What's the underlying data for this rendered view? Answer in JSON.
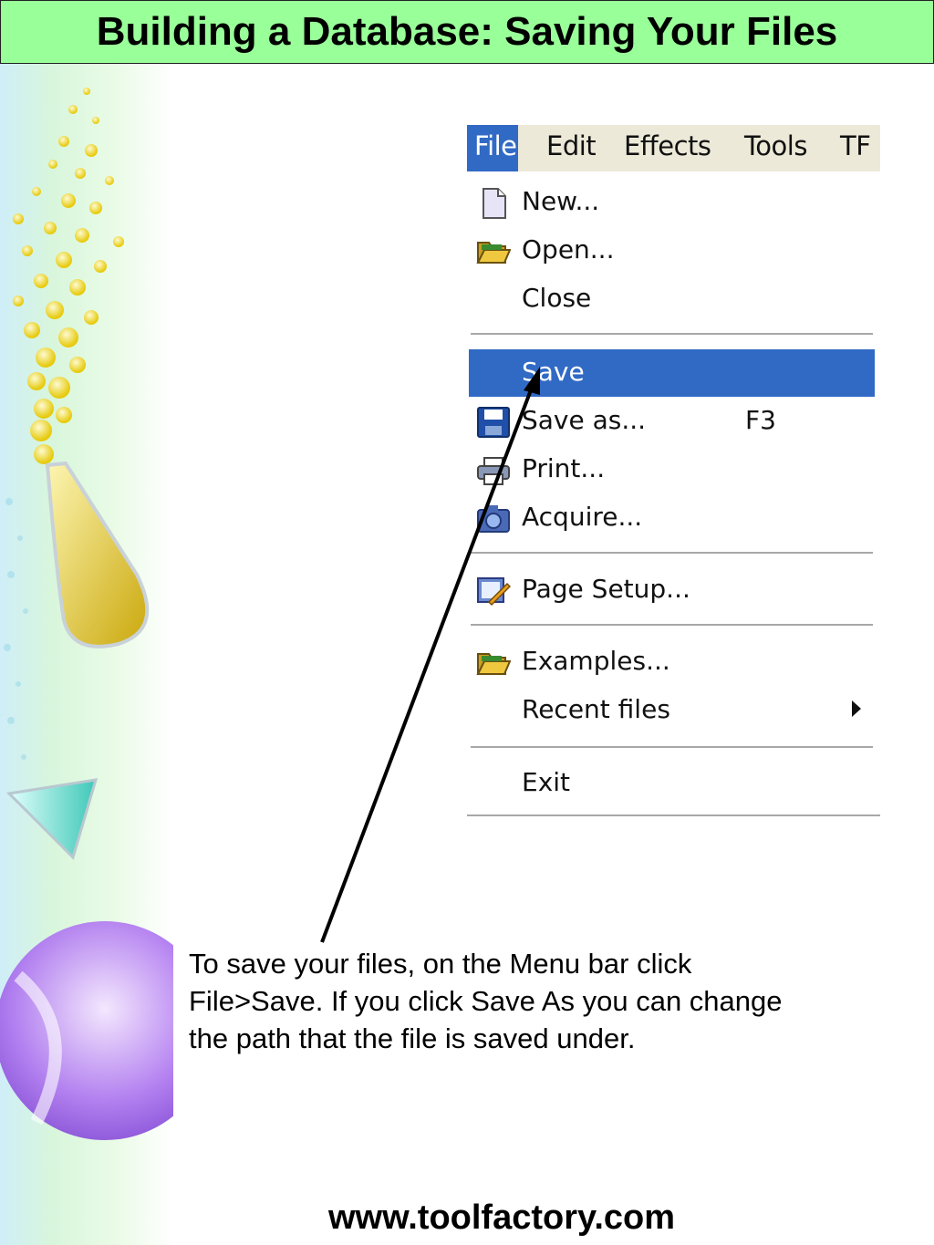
{
  "slide": {
    "title": "Building a Database: Saving Your Files",
    "caption": "To save your files, on the Menu bar click\nFile>Save.  If you click Save As you can change\nthe path that the file is saved under.",
    "footer_url": "www.toolfactory.com"
  },
  "menubar": {
    "items": [
      "File",
      "Edit",
      "Effects",
      "Tools",
      "TF"
    ],
    "active": "File"
  },
  "file_menu": {
    "items": [
      {
        "label": "New...",
        "icon": "new-document-icon"
      },
      {
        "label": "Open...",
        "icon": "open-folder-icon"
      },
      {
        "label": "Close",
        "icon": ""
      },
      {
        "label": "Save",
        "icon": "",
        "selected": true
      },
      {
        "label": "Save as...",
        "icon": "floppy-disk-icon",
        "shortcut": "F3"
      },
      {
        "label": "Print...",
        "icon": "printer-icon"
      },
      {
        "label": "Acquire...",
        "icon": "camera-icon"
      },
      {
        "label": "Page Setup...",
        "icon": "page-setup-icon"
      },
      {
        "label": "Examples...",
        "icon": "open-folder-icon"
      },
      {
        "label": "Recent files",
        "icon": "",
        "submenu": true
      },
      {
        "label": "Exit",
        "icon": ""
      }
    ]
  },
  "colors": {
    "title_background": "#99ff99",
    "menu_highlight": "#316ac5",
    "menubar_background": "#ece9d8"
  }
}
